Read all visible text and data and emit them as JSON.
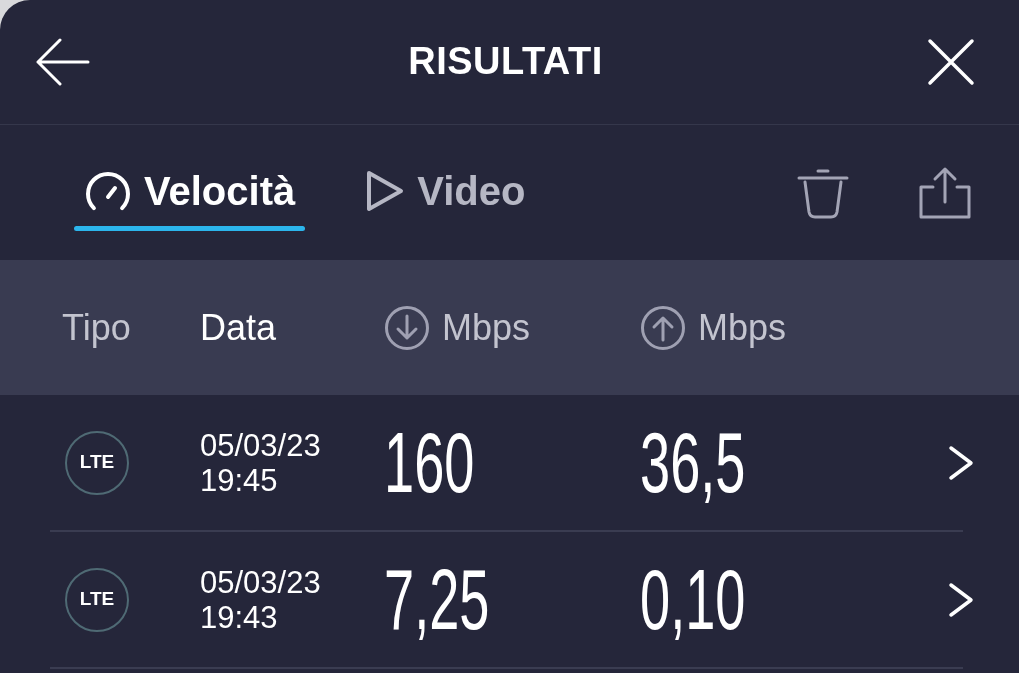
{
  "header": {
    "title": "RISULTATI"
  },
  "tabs": [
    {
      "label": "Velocità",
      "kind": "speed",
      "selected": true
    },
    {
      "label": "Video",
      "kind": "video",
      "selected": false
    }
  ],
  "table": {
    "columns": [
      {
        "label": "Tipo",
        "kind": "text",
        "selected": false
      },
      {
        "label": "Data",
        "kind": "text",
        "selected": true
      },
      {
        "label": "Mbps",
        "kind": "download",
        "selected": false
      },
      {
        "label": "Mbps",
        "kind": "upload",
        "selected": false
      }
    ],
    "rows": [
      {
        "type": "LTE",
        "date": "05/03/23",
        "time": "19:45",
        "download": "160",
        "upload": "36,5"
      },
      {
        "type": "LTE",
        "date": "05/03/23",
        "time": "19:43",
        "download": "7,25",
        "upload": "0,10"
      }
    ]
  }
}
